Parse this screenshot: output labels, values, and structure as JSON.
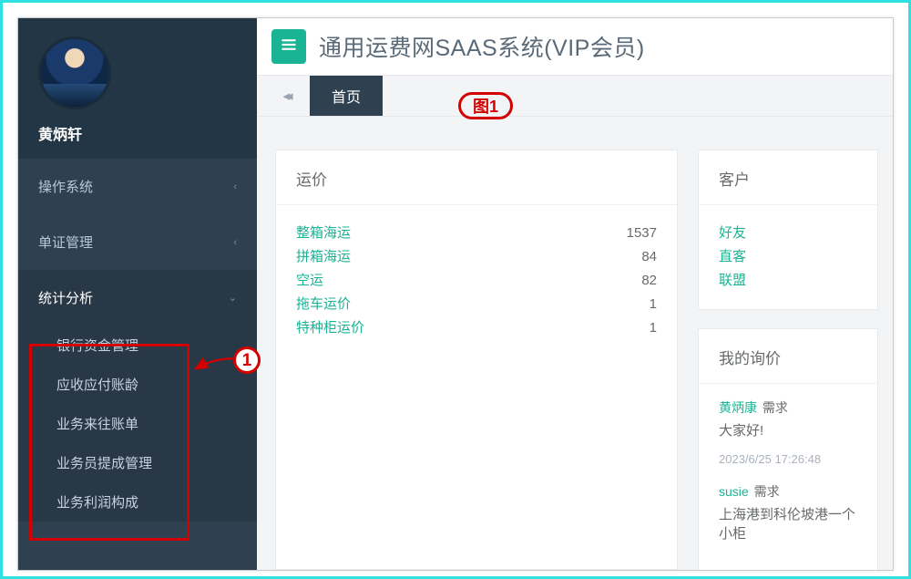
{
  "annotations": {
    "callout1": "1",
    "figure_label": "图1"
  },
  "sidebar": {
    "username": "黄炳轩",
    "items": [
      {
        "label": "操作系统",
        "expanded": false
      },
      {
        "label": "单证管理",
        "expanded": false
      },
      {
        "label": "统计分析",
        "expanded": true
      }
    ],
    "subitems": [
      {
        "label": "银行资金管理"
      },
      {
        "label": "应收应付账龄"
      },
      {
        "label": "业务来往账单"
      },
      {
        "label": "业务员提成管理"
      },
      {
        "label": "业务利润构成"
      }
    ]
  },
  "header": {
    "app_title": "通用运费网SAAS系统(VIP会员)"
  },
  "tabs": {
    "home": "首页"
  },
  "freight": {
    "title": "运价",
    "rows": [
      {
        "label": "整箱海运",
        "value": "1537"
      },
      {
        "label": "拼箱海运",
        "value": "84"
      },
      {
        "label": "空运",
        "value": "82"
      },
      {
        "label": "拖车运价",
        "value": "1"
      },
      {
        "label": "特种柜运价",
        "value": "1"
      }
    ]
  },
  "customers": {
    "title": "客户",
    "links": [
      {
        "label": "好友"
      },
      {
        "label": "直客"
      },
      {
        "label": "联盟"
      }
    ]
  },
  "inquiry": {
    "title": "我的询价",
    "items": [
      {
        "name": "黄炳康",
        "tag": "需求",
        "msg": "大家好!",
        "time": "2023/6/25 17:26:48"
      },
      {
        "name": "susie",
        "tag": "需求",
        "msg": "上海港到科伦坡港一个小柜",
        "time": ""
      }
    ]
  }
}
